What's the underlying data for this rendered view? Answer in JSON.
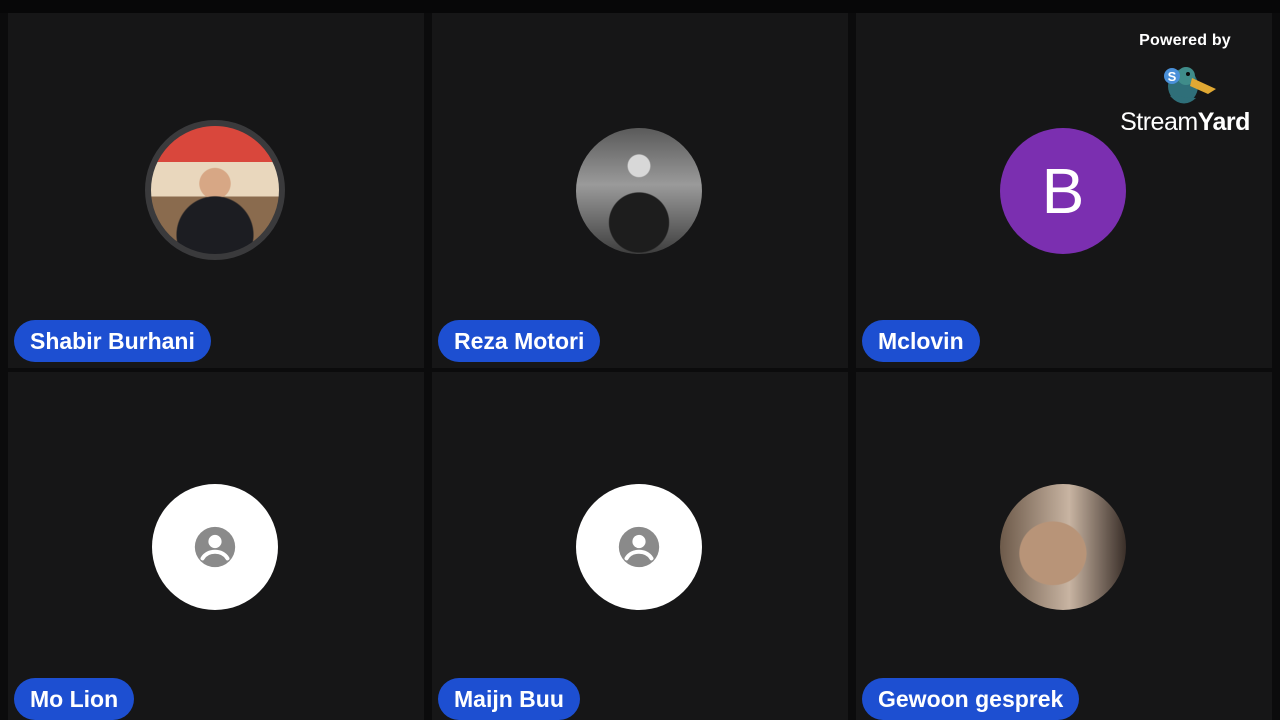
{
  "participants": [
    {
      "name": "Shabir Burhani",
      "avatar_type": "photo"
    },
    {
      "name": "Reza Motori",
      "avatar_type": "photo"
    },
    {
      "name": "Mclovin",
      "avatar_type": "initial",
      "initial": "B",
      "avatar_color": "#7b2fb0"
    },
    {
      "name": "Mo Lion",
      "avatar_type": "placeholder",
      "icon": "user-placeholder-icon"
    },
    {
      "name": "Maijn Buu",
      "avatar_type": "placeholder",
      "icon": "user-placeholder-icon"
    },
    {
      "name": "Gewoon gesprek",
      "avatar_type": "photo"
    }
  ],
  "branding": {
    "powered_by": "Powered by",
    "brand_regular": "Stream",
    "brand_bold": "Yard",
    "logo_icon": "streamyard-duck-icon"
  },
  "colors": {
    "name_pill": "#1d4fd1",
    "tile_background": "#161617",
    "placeholder_icon": "#8a8a8a"
  }
}
